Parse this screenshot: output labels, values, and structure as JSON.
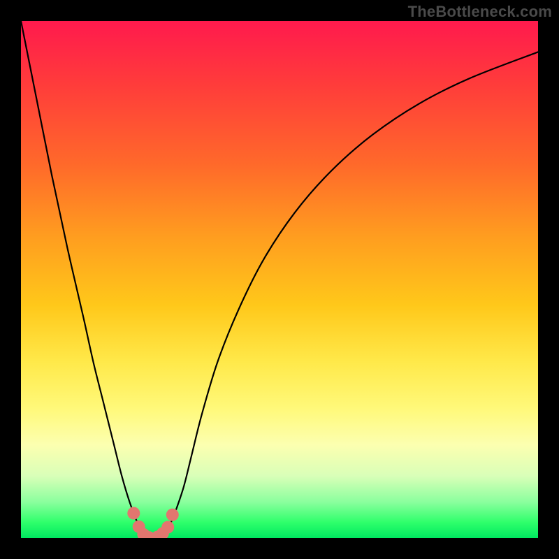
{
  "watermark": "TheBottleneck.com",
  "chart_data": {
    "type": "line",
    "title": "",
    "xlabel": "",
    "ylabel": "",
    "xlim": [
      0,
      100
    ],
    "ylim": [
      0,
      100
    ],
    "grid": false,
    "legend": false,
    "series": [
      {
        "name": "curve",
        "stroke": "#000000",
        "x": [
          0,
          3,
          6,
          9,
          12,
          14,
          16,
          18,
          19.5,
          21,
          22.3,
          23.3,
          24.2,
          25,
          26,
          27,
          28,
          29,
          30,
          31.5,
          33,
          35,
          38,
          42,
          47,
          53,
          60,
          68,
          77,
          87,
          100
        ],
        "y": [
          100,
          85,
          70,
          56,
          43,
          34,
          26,
          18,
          12,
          7,
          3.5,
          1.5,
          0.4,
          0,
          0,
          0.4,
          1.3,
          3,
          5.5,
          10,
          16,
          24,
          34,
          44,
          54,
          63,
          71,
          78,
          84,
          89,
          94
        ]
      }
    ],
    "markers": [
      {
        "x": 21.8,
        "y": 4.8
      },
      {
        "x": 22.8,
        "y": 2.2
      },
      {
        "x": 23.7,
        "y": 0.7
      },
      {
        "x": 24.8,
        "y": 0.1
      },
      {
        "x": 26.4,
        "y": 0.2
      },
      {
        "x": 27.4,
        "y": 0.9
      },
      {
        "x": 28.4,
        "y": 2.1
      },
      {
        "x": 29.3,
        "y": 4.5
      }
    ],
    "marker_style": {
      "fill": "#e2766f",
      "radius_px": 9
    }
  }
}
